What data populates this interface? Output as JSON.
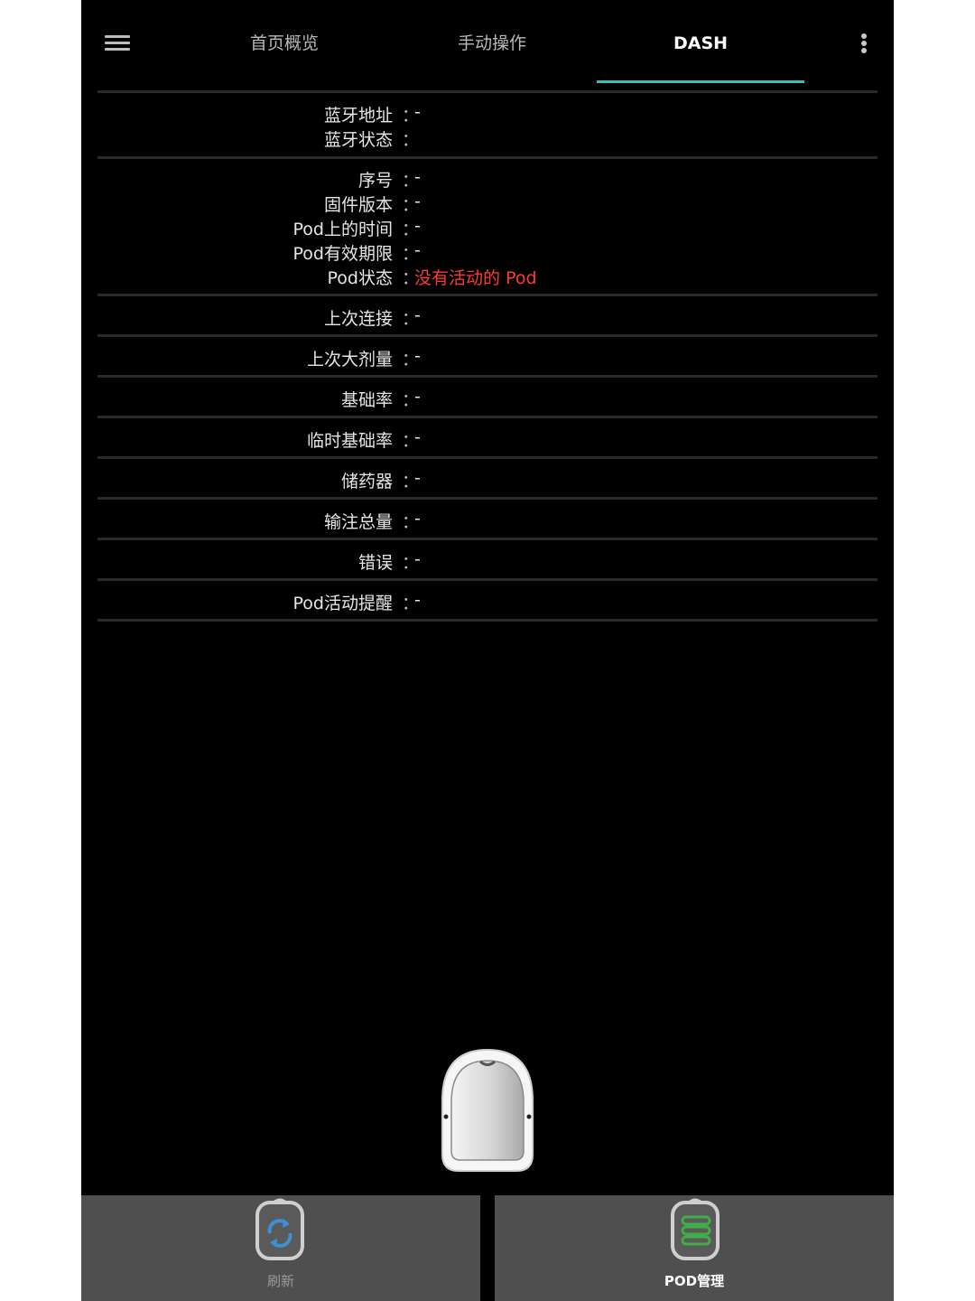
{
  "header": {
    "tabs": [
      {
        "label": "首页概览",
        "active": false
      },
      {
        "label": "手动操作",
        "active": false
      },
      {
        "label": "DASH",
        "active": true
      }
    ],
    "accent_color": "#2ec4b6"
  },
  "info": {
    "bluetooth": [
      {
        "label": "蓝牙地址",
        "value": "-"
      },
      {
        "label": "蓝牙状态",
        "value": ""
      }
    ],
    "pod": [
      {
        "label": "序号",
        "value": "-"
      },
      {
        "label": "固件版本",
        "value": "-"
      },
      {
        "label": "Pod上的时间",
        "value": "-"
      },
      {
        "label": "Pod有效期限",
        "value": "-"
      },
      {
        "label": "Pod状态",
        "value": "没有活动的 Pod",
        "alert_color": "#ff3b30"
      }
    ],
    "last_connection": {
      "label": "上次连接",
      "value": "-"
    },
    "last_bolus": {
      "label": "上次大剂量",
      "value": "-"
    },
    "basal_rate": {
      "label": "基础率",
      "value": "-"
    },
    "temp_basal": {
      "label": "临时基础率",
      "value": "-"
    },
    "reservoir": {
      "label": "储药器",
      "value": "-"
    },
    "total_delivered": {
      "label": "输注总量",
      "value": "-"
    },
    "errors": {
      "label": "错误",
      "value": "-"
    },
    "pod_alerts": {
      "label": "Pod活动提醒",
      "value": "-"
    },
    "separator": "："
  },
  "footer": {
    "refresh": {
      "label": "刷新",
      "enabled": false,
      "icon": "refresh-icon",
      "icon_color": "#3d8fd6"
    },
    "pod_management": {
      "label": "POD管理",
      "enabled": true,
      "icon": "pod-management-icon",
      "icon_color": "#3fae49"
    }
  }
}
